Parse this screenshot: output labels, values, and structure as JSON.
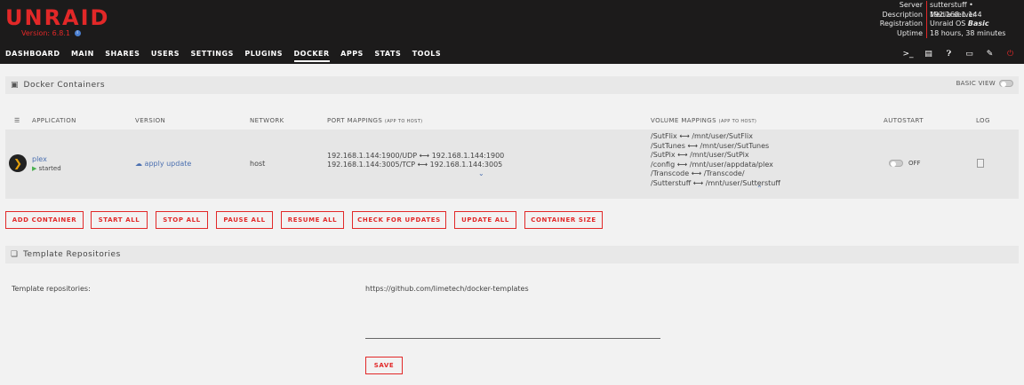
{
  "header": {
    "logo": "UNRAID",
    "version": "Version: 6.8.1",
    "info_icon": "i",
    "server_info": [
      {
        "key": "Server",
        "value": "sutterstuff • 192.168.1.144"
      },
      {
        "key": "Description",
        "value": "Media server"
      },
      {
        "key": "Registration",
        "value": "Unraid OS ",
        "value_em": "Basic"
      },
      {
        "key": "Uptime",
        "value": "18 hours, 38 minutes"
      }
    ]
  },
  "nav": {
    "items": [
      "DASHBOARD",
      "MAIN",
      "SHARES",
      "USERS",
      "SETTINGS",
      "PLUGINS",
      "DOCKER",
      "APPS",
      "STATS",
      "TOOLS"
    ],
    "active": "DOCKER",
    "icons": [
      "terminal-icon",
      "notes-icon",
      "help-icon",
      "monitor-icon",
      "feedback-icon",
      "power-icon"
    ]
  },
  "docker": {
    "title": "Docker Containers",
    "basic_view_label": "BASIC VIEW",
    "columns": {
      "application": "APPLICATION",
      "version": "VERSION",
      "network": "NETWORK",
      "port_mappings": "PORT MAPPINGS",
      "port_mappings_sub": "(APP TO HOST)",
      "volume_mappings": "VOLUME MAPPINGS",
      "volume_mappings_sub": "(APP TO HOST)",
      "autostart": "AUTOSTART",
      "log": "LOG"
    },
    "containers": [
      {
        "name": "plex",
        "status": "started",
        "version": "apply update",
        "network": "host",
        "ports": [
          {
            "app": "192.168.1.144:1900/UDP",
            "host": "192.168.1.144:1900"
          },
          {
            "app": "192.168.1.144:3005/TCP",
            "host": "192.168.1.144:3005"
          }
        ],
        "volumes": [
          {
            "app": "/SutFlix",
            "host": "/mnt/user/SutFlix"
          },
          {
            "app": "/SutTunes",
            "host": "/mnt/user/SutTunes"
          },
          {
            "app": "/SutPix",
            "host": "/mnt/user/SutPix"
          },
          {
            "app": "/config",
            "host": "/mnt/user/appdata/plex"
          },
          {
            "app": "/Transcode",
            "host": "/Transcode/"
          },
          {
            "app": "/Sutterstuff",
            "host": "/mnt/user/Sutterstuff"
          }
        ],
        "autostart_label": "OFF"
      }
    ],
    "buttons": [
      "ADD CONTAINER",
      "START ALL",
      "STOP ALL",
      "PAUSE ALL",
      "RESUME ALL",
      "CHECK FOR UPDATES",
      "UPDATE ALL",
      "CONTAINER SIZE"
    ]
  },
  "templates": {
    "title": "Template Repositories",
    "label": "Template repositories:",
    "url": "https://github.com/limetech/docker-templates",
    "save_label": "SAVE"
  },
  "colors": {
    "accent": "#e22828",
    "header_bg": "#1c1b1b",
    "link": "#4a6fb0"
  }
}
